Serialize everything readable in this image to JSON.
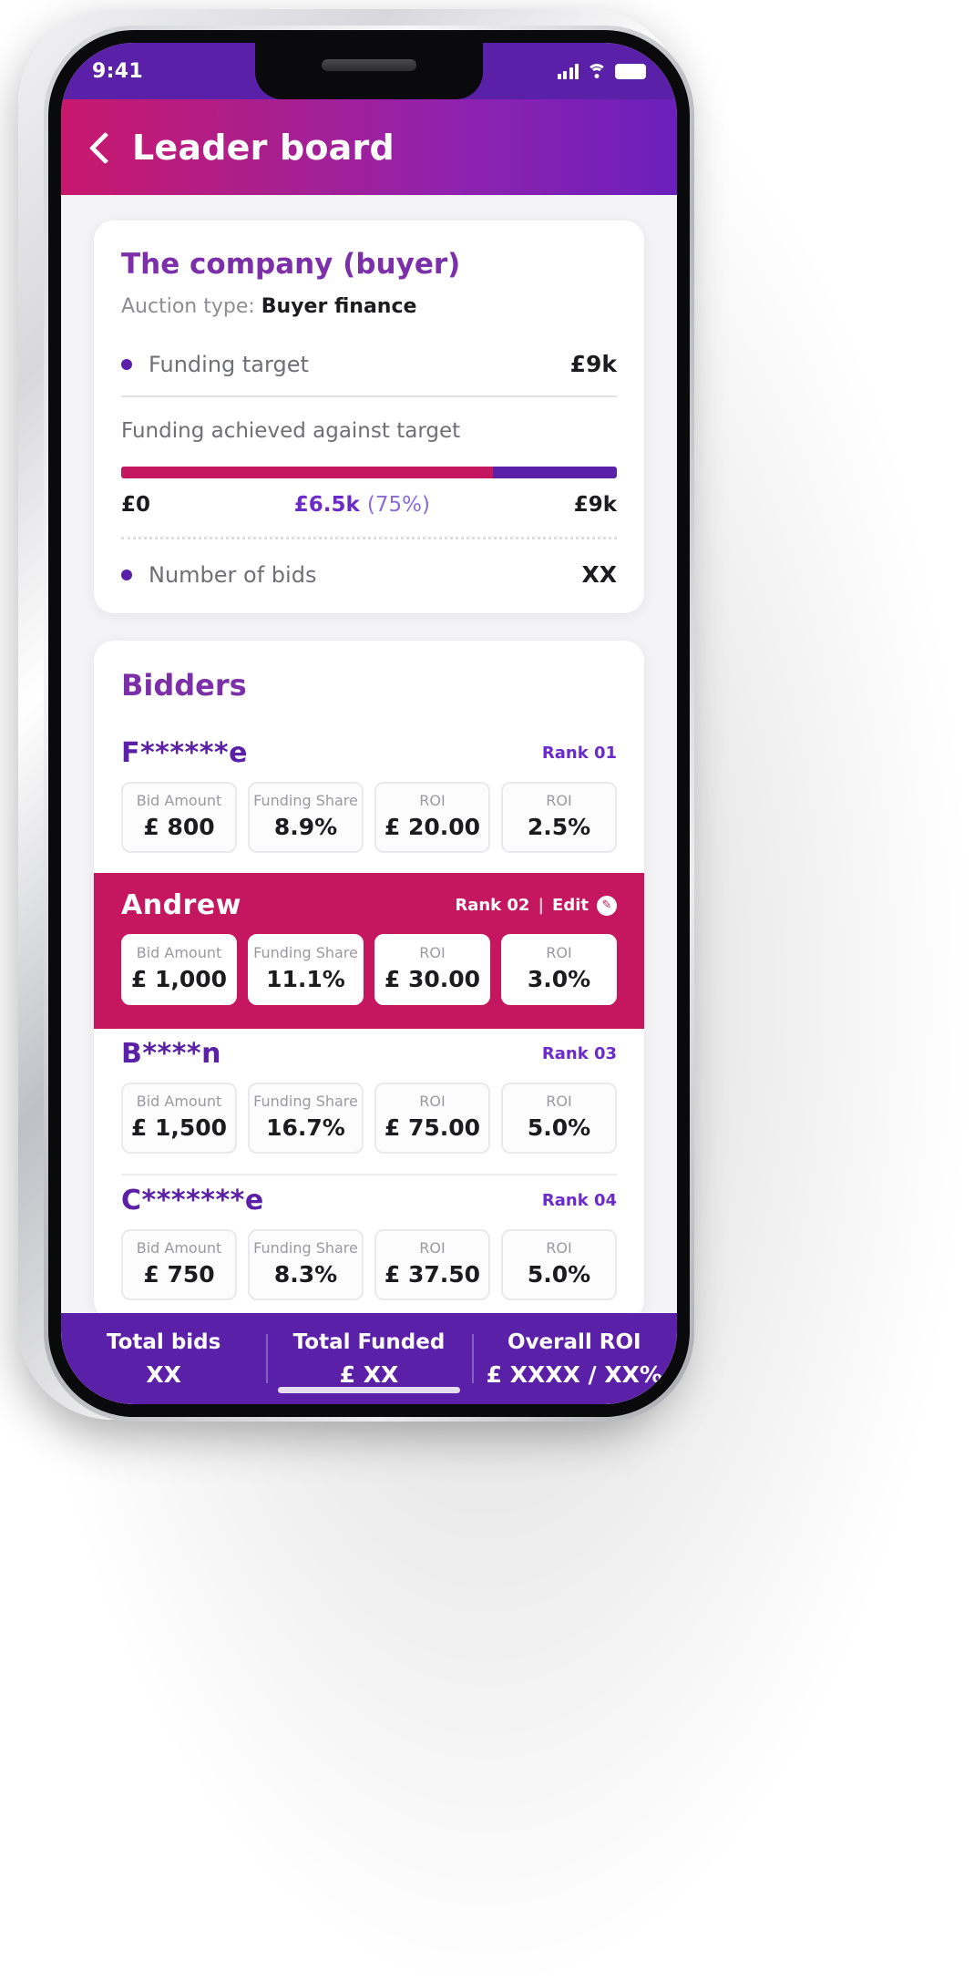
{
  "status_bar": {
    "time": "9:41",
    "signal_icon": "cellular-signal-icon",
    "wifi_icon": "wifi-icon",
    "battery_icon": "battery-icon"
  },
  "header": {
    "back_icon": "back-chevron-icon",
    "title": "Leader board"
  },
  "company_card": {
    "title": "The company (buyer)",
    "auction_type_label": "Auction type:",
    "auction_type_value": "Buyer finance",
    "funding_target": {
      "label": "Funding target",
      "value": "£9k"
    },
    "progress": {
      "caption": "Funding achieved against target",
      "start_label": "£0",
      "achieved_label": "£6.5k",
      "achieved_percent_label": "(75%)",
      "end_label": "£9k",
      "percent": 75,
      "fill_color": "#c4175f",
      "track_color": "#5b20a8"
    },
    "number_of_bids": {
      "label": "Number of bids",
      "value": "XX"
    }
  },
  "bidders_card": {
    "title": "Bidders",
    "stat_labels": [
      "Bid Amount",
      "Funding Share",
      "ROI",
      "ROI"
    ],
    "rows": [
      {
        "name": "F******e",
        "rank": "Rank 01",
        "highlighted": false,
        "bid_amount": "£ 800",
        "funding_share": "8.9%",
        "roi_value": "£ 20.00",
        "roi_percent": "2.5%"
      },
      {
        "name": "Andrew",
        "rank": "Rank 02",
        "rank_separator": "|",
        "edit_label": "Edit",
        "edit_icon": "pencil-icon",
        "highlighted": true,
        "bid_amount": "£ 1,000",
        "funding_share": "11.1%",
        "roi_value": "£ 30.00",
        "roi_percent": "3.0%"
      },
      {
        "name": "B****n",
        "rank": "Rank 03",
        "highlighted": false,
        "bid_amount": "£ 1,500",
        "funding_share": "16.7%",
        "roi_value": "£ 75.00",
        "roi_percent": "5.0%"
      },
      {
        "name": "C*******e",
        "rank": "Rank 04",
        "highlighted": false,
        "bid_amount": "£ 750",
        "funding_share": "8.3%",
        "roi_value": "£ 37.50",
        "roi_percent": "5.0%"
      }
    ]
  },
  "summary_bar": {
    "cells": [
      {
        "label": "Total bids",
        "value": "XX"
      },
      {
        "label": "Total Funded",
        "value": "£ XX"
      },
      {
        "label": "Overall ROI",
        "value": "£ XXXX  / XX%"
      }
    ]
  },
  "theme": {
    "purple": "#5b20a8",
    "magenta": "#c4175f",
    "title_purple": "#7b2fa8",
    "background": "#f4f4f6"
  }
}
